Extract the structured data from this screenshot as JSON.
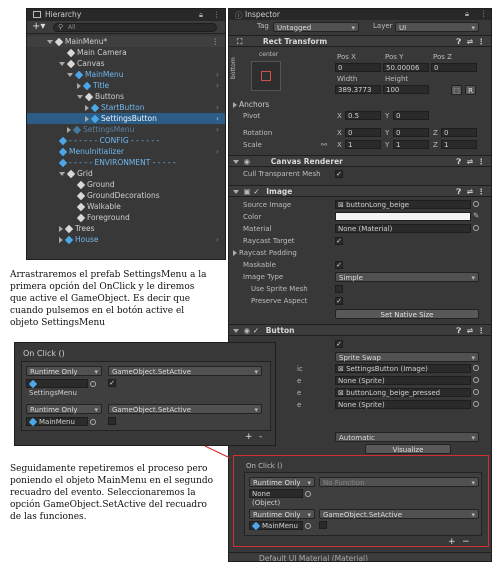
{
  "hierarchy": {
    "title": "Hierarchy",
    "search_placeholder": "All",
    "items": [
      {
        "label": "MainMenu*"
      },
      {
        "label": "Main Camera"
      },
      {
        "label": "Canvas"
      },
      {
        "label": "MainMenu"
      },
      {
        "label": "Title"
      },
      {
        "label": "Buttons"
      },
      {
        "label": "StartButton"
      },
      {
        "label": "SettingsButton"
      },
      {
        "label": "SettingsMenu"
      },
      {
        "label": "- - - - - - CONFIG - - - - - -"
      },
      {
        "label": "MenuInitializer"
      },
      {
        "label": "- - - - - ENVIRONMENT - - - - -"
      },
      {
        "label": "Grid"
      },
      {
        "label": "Ground"
      },
      {
        "label": "GroundDecorations"
      },
      {
        "label": "Walkable"
      },
      {
        "label": "Foreground"
      },
      {
        "label": "Trees"
      },
      {
        "label": "House"
      }
    ]
  },
  "inspector": {
    "title": "Inspector",
    "tag_label": "Tag",
    "tag_value": "Untagged",
    "layer_label": "Layer",
    "layer_value": "UI",
    "rect_transform": {
      "title": "Rect Transform",
      "anchor_label": "center",
      "side_label": "bottom",
      "pos_x_label": "Pos X",
      "pos_y_label": "Pos Y",
      "pos_z_label": "Pos Z",
      "pos_x": "0",
      "pos_y": "50.00006",
      "pos_z": "0",
      "width_label": "Width",
      "height_label": "Height",
      "width": "389.3773",
      "height": "100",
      "anchors_label": "Anchors",
      "pivot_label": "Pivot",
      "pivot_x": "0.5",
      "pivot_y": "0",
      "rotation_label": "Rotation",
      "rot_x": "0",
      "rot_y": "0",
      "rot_z": "0",
      "scale_label": "Scale",
      "scale_x": "1",
      "scale_y": "1",
      "scale_z": "1",
      "axis_x": "X",
      "axis_y": "Y",
      "axis_z": "Z",
      "r_btn": "R"
    },
    "canvas_renderer": {
      "title": "Canvas Renderer",
      "cull_label": "Cull Transparent Mesh"
    },
    "image": {
      "title": "Image",
      "source_label": "Source Image",
      "source_value": "buttonLong_beige",
      "color_label": "Color",
      "material_label": "Material",
      "material_value": "None (Material)",
      "raycast_label": "Raycast Target",
      "padding_label": "Raycast Padding",
      "maskable_label": "Maskable",
      "type_label": "Image Type",
      "type_value": "Simple",
      "sprite_mesh_label": "Use Sprite Mesh",
      "preserve_label": "Preserve Aspect",
      "native_btn": "Set Native Size"
    },
    "button": {
      "title": "Button",
      "transition_value": "Sprite Swap",
      "target_suffix": "ic",
      "target_value": "SettingsButton (Image)",
      "row2_suffix": "e",
      "row2_value": "None (Sprite)",
      "row3_suffix": "e",
      "row3_value": "buttonLong_beige_pressed",
      "row4_suffix": "e",
      "row4_value": "None (Sprite)",
      "nav_value": "Automatic",
      "visualize": "Visualize"
    },
    "onclick_small": {
      "title": "On Click ()",
      "runtime": "Runtime Only",
      "function_none": "No Function",
      "none_object": "None (Object)",
      "runtime2": "Runtime Only",
      "function2": "GameObject.SetActive",
      "object2": "MainMenu"
    },
    "footer": "Default UI Material (Material)"
  },
  "overlay_onclick": {
    "title": "On Click ()",
    "runtime1": "Runtime Only",
    "function1": "GameObject.SetActive",
    "object1": "SettingsMenu",
    "runtime2": "Runtime Only",
    "function2": "GameObject.SetActive",
    "object2": "MainMenu",
    "plus": "+",
    "minus": "-"
  },
  "captions": {
    "first": "Arrastraremos el prefab SettingsMenu a la primera opción del OnClick y le diremos que active el GameObject. Es decir que cuando pulsemos en el botón active el objeto SettingsMenu",
    "second": "Seguidamente repetiremos el proceso pero poniendo el objeto MainMenu en el segundo recuadro del evento. Seleccionaremos la opción GameObject.SetActive del recuadro de las funciones."
  },
  "colors": {
    "panel": "#383838",
    "selection": "#2c5d87",
    "accent": "#3aa0d8",
    "callout_border": "#d03030"
  }
}
